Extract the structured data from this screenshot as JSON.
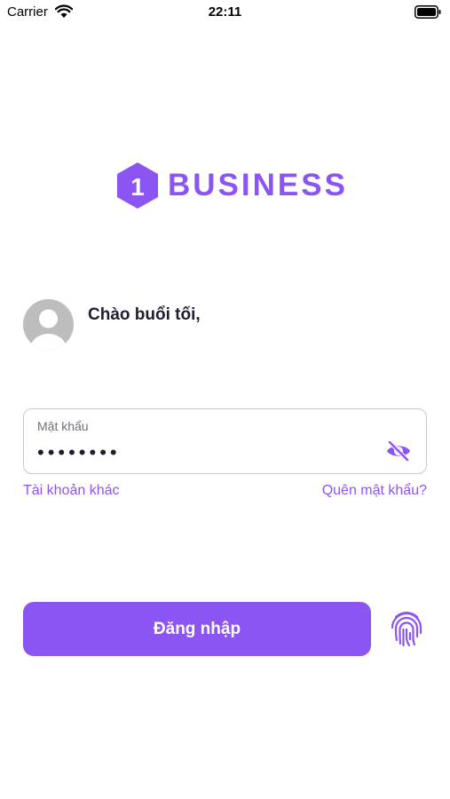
{
  "status_bar": {
    "carrier": "Carrier",
    "time": "22:11"
  },
  "logo": {
    "badge": "1",
    "text": "BUSINESS"
  },
  "user": {
    "greeting": "Chào buổi tối,"
  },
  "password_field": {
    "label": "Mật khẩu",
    "value": "••••••••"
  },
  "links": {
    "other_account": "Tài khoản khác",
    "forgot_password": "Quên mật khẩu?"
  },
  "login_button": {
    "label": "Đăng nhập"
  },
  "colors": {
    "accent": "#8b55f3",
    "text": "#1e1e30",
    "avatar": "#bdbdbd"
  }
}
